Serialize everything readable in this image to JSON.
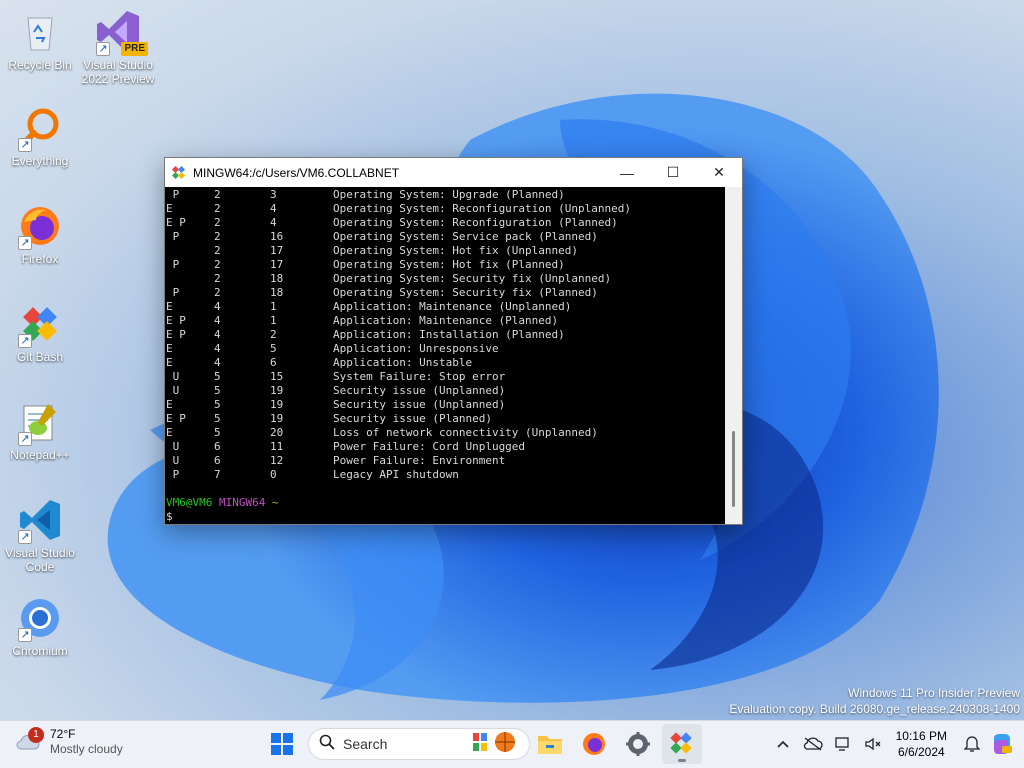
{
  "desktop": {
    "icons": [
      {
        "label": "Recycle Bin",
        "icon": "recycle-bin-icon"
      },
      {
        "label": "Visual Studio 2022 Preview",
        "icon": "visual-studio-icon",
        "badge": "PRE"
      },
      {
        "label": "Everything",
        "icon": "everything-search-icon"
      },
      {
        "label": "Firefox",
        "icon": "firefox-icon"
      },
      {
        "label": "Git Bash",
        "icon": "git-bash-icon"
      },
      {
        "label": "Notepad++",
        "icon": "notepad-plus-plus-icon"
      },
      {
        "label": "Visual Studio Code",
        "icon": "vscode-icon"
      },
      {
        "label": "Chromium",
        "icon": "chromium-icon"
      }
    ]
  },
  "terminal": {
    "title": "MINGW64:/c/Users/VM6.COLLABNET",
    "controls": {
      "minimize": "—",
      "maximize": "☐",
      "close": "✕"
    },
    "rows": [
      {
        "flags": " P",
        "major": "2",
        "minor": "3",
        "reason": "Operating System: Upgrade (Planned)"
      },
      {
        "flags": "E",
        "major": "2",
        "minor": "4",
        "reason": "Operating System: Reconfiguration (Unplanned)"
      },
      {
        "flags": "E P",
        "major": "2",
        "minor": "4",
        "reason": "Operating System: Reconfiguration (Planned)"
      },
      {
        "flags": " P",
        "major": "2",
        "minor": "16",
        "reason": "Operating System: Service pack (Planned)"
      },
      {
        "flags": "",
        "major": "2",
        "minor": "17",
        "reason": "Operating System: Hot fix (Unplanned)"
      },
      {
        "flags": " P",
        "major": "2",
        "minor": "17",
        "reason": "Operating System: Hot fix (Planned)"
      },
      {
        "flags": "",
        "major": "2",
        "minor": "18",
        "reason": "Operating System: Security fix (Unplanned)"
      },
      {
        "flags": " P",
        "major": "2",
        "minor": "18",
        "reason": "Operating System: Security fix (Planned)"
      },
      {
        "flags": "E",
        "major": "4",
        "minor": "1",
        "reason": "Application: Maintenance (Unplanned)"
      },
      {
        "flags": "E P",
        "major": "4",
        "minor": "1",
        "reason": "Application: Maintenance (Planned)"
      },
      {
        "flags": "E P",
        "major": "4",
        "minor": "2",
        "reason": "Application: Installation (Planned)"
      },
      {
        "flags": "E",
        "major": "4",
        "minor": "5",
        "reason": "Application: Unresponsive"
      },
      {
        "flags": "E",
        "major": "4",
        "minor": "6",
        "reason": "Application: Unstable"
      },
      {
        "flags": " U",
        "major": "5",
        "minor": "15",
        "reason": "System Failure: Stop error"
      },
      {
        "flags": " U",
        "major": "5",
        "minor": "19",
        "reason": "Security issue (Unplanned)"
      },
      {
        "flags": "E",
        "major": "5",
        "minor": "19",
        "reason": "Security issue (Unplanned)"
      },
      {
        "flags": "E P",
        "major": "5",
        "minor": "19",
        "reason": "Security issue (Planned)"
      },
      {
        "flags": "E",
        "major": "5",
        "minor": "20",
        "reason": "Loss of network connectivity (Unplanned)"
      },
      {
        "flags": " U",
        "major": "6",
        "minor": "11",
        "reason": "Power Failure: Cord Unplugged"
      },
      {
        "flags": " U",
        "major": "6",
        "minor": "12",
        "reason": "Power Failure: Environment"
      },
      {
        "flags": " P",
        "major": "7",
        "minor": "0",
        "reason": "Legacy API shutdown"
      }
    ],
    "prompt": {
      "user_host": "VM6@VM6",
      "system": "MINGW64",
      "path": "~",
      "symbol": "$"
    }
  },
  "watermark": {
    "line1": "Windows 11 Pro Insider Preview",
    "line2": "Evaluation copy. Build 26080.ge_release.240308-1400"
  },
  "taskbar": {
    "weather": {
      "temp": "72°F",
      "condition": "Mostly cloudy",
      "badge": "1"
    },
    "search_label": "Search",
    "apps": [
      "start-icon",
      "widgets-icon",
      "file-explorer-icon",
      "firefox-icon",
      "settings-icon",
      "git-bash-icon"
    ],
    "tray": {
      "time": "10:16 PM",
      "date": "6/6/2024"
    }
  }
}
